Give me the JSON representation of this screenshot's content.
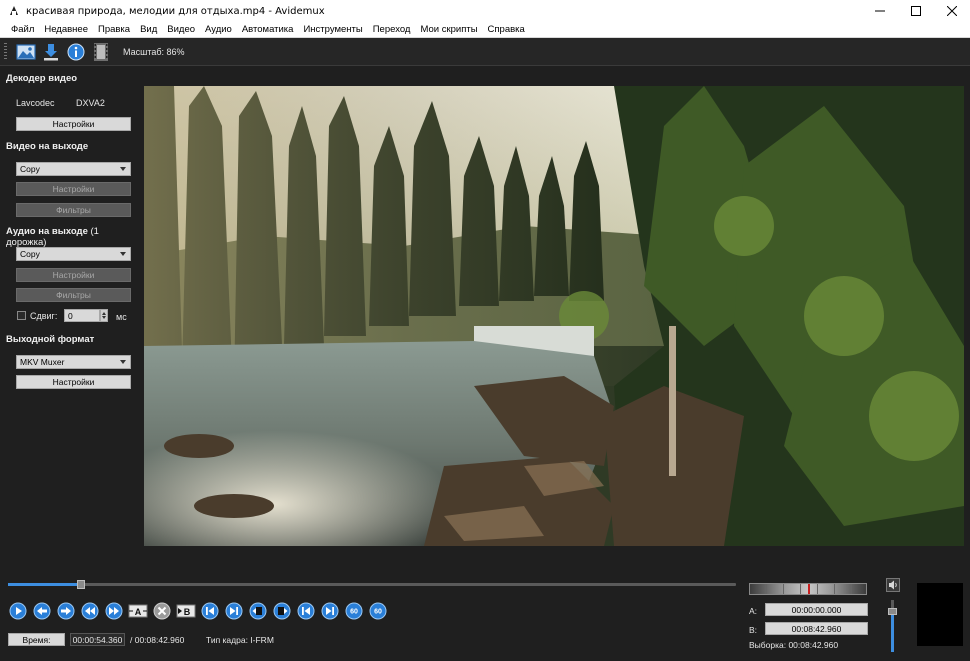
{
  "window": {
    "title": "красивая природа, мелодии для отдыха.mp4 - Avidemux"
  },
  "menu": [
    "Файл",
    "Недавнее",
    "Правка",
    "Вид",
    "Видео",
    "Аудио",
    "Автоматика",
    "Инструменты",
    "Переход",
    "Мои скрипты",
    "Справка"
  ],
  "toolbar": {
    "zoom_label": "Масштаб: 86%"
  },
  "decoder": {
    "title": "Декодер видео",
    "name": "Lavcodec",
    "hw": "DXVA2",
    "settings": "Настройки"
  },
  "video_out": {
    "title": "Видео на выходе",
    "codec": "Copy",
    "settings": "Настройки",
    "filters": "Фильтры"
  },
  "audio_out": {
    "title": "Аудио на выходе",
    "tracks": "(1 дорожка)",
    "codec": "Copy",
    "settings": "Настройки",
    "filters": "Фильтры",
    "shift_label": "Сдвиг:",
    "shift_value": "0",
    "shift_unit": "мс"
  },
  "output_format": {
    "title": "Выходной формат",
    "muxer": "MKV Muxer",
    "settings": "Настройки"
  },
  "playback": {
    "position_fraction": 0.1,
    "time_button": "Время:",
    "current_time": "00:00:54.360",
    "total_time": "/ 00:08:42.960",
    "frame_type": "Тип кадра:  I-FRM"
  },
  "selection": {
    "a_label": "A:",
    "a_value": "00:00:00.000",
    "b_label": "B:",
    "b_value": "00:08:42.960",
    "duration": "Выборка: 00:08:42.960"
  },
  "colors": {
    "accent": "#3d8ee0",
    "marker": "#c81e1e"
  }
}
